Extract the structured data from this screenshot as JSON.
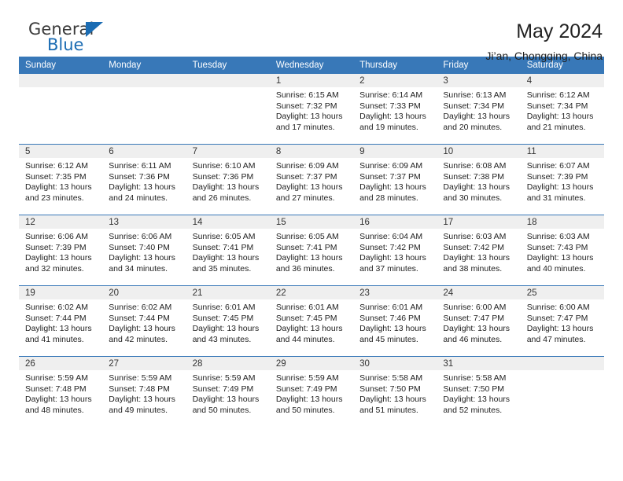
{
  "brand": {
    "word_one": "General",
    "word_two": "Blue",
    "triangle_icon": "triangle-icon",
    "accent_color": "#1b6cb3"
  },
  "header": {
    "title": "May 2024",
    "subtitle": "Ji’an, Chongqing, China"
  },
  "theme": {
    "header_blue": "#3878b8",
    "daynum_strip": "#efefef",
    "text": "#222222"
  },
  "calendar": {
    "weekday_headers": [
      "Sunday",
      "Monday",
      "Tuesday",
      "Wednesday",
      "Thursday",
      "Friday",
      "Saturday"
    ],
    "weeks": [
      [
        {
          "day": "",
          "sunrise": "",
          "sunset": "",
          "daylight_line1": "",
          "daylight_line2": "",
          "empty": true
        },
        {
          "day": "",
          "sunrise": "",
          "sunset": "",
          "daylight_line1": "",
          "daylight_line2": "",
          "empty": true
        },
        {
          "day": "",
          "sunrise": "",
          "sunset": "",
          "daylight_line1": "",
          "daylight_line2": "",
          "empty": true
        },
        {
          "day": "1",
          "sunrise": "Sunrise: 6:15 AM",
          "sunset": "Sunset: 7:32 PM",
          "daylight_line1": "Daylight: 13 hours",
          "daylight_line2": "and 17 minutes.",
          "empty": false
        },
        {
          "day": "2",
          "sunrise": "Sunrise: 6:14 AM",
          "sunset": "Sunset: 7:33 PM",
          "daylight_line1": "Daylight: 13 hours",
          "daylight_line2": "and 19 minutes.",
          "empty": false
        },
        {
          "day": "3",
          "sunrise": "Sunrise: 6:13 AM",
          "sunset": "Sunset: 7:34 PM",
          "daylight_line1": "Daylight: 13 hours",
          "daylight_line2": "and 20 minutes.",
          "empty": false
        },
        {
          "day": "4",
          "sunrise": "Sunrise: 6:12 AM",
          "sunset": "Sunset: 7:34 PM",
          "daylight_line1": "Daylight: 13 hours",
          "daylight_line2": "and 21 minutes.",
          "empty": false
        }
      ],
      [
        {
          "day": "5",
          "sunrise": "Sunrise: 6:12 AM",
          "sunset": "Sunset: 7:35 PM",
          "daylight_line1": "Daylight: 13 hours",
          "daylight_line2": "and 23 minutes.",
          "empty": false
        },
        {
          "day": "6",
          "sunrise": "Sunrise: 6:11 AM",
          "sunset": "Sunset: 7:36 PM",
          "daylight_line1": "Daylight: 13 hours",
          "daylight_line2": "and 24 minutes.",
          "empty": false
        },
        {
          "day": "7",
          "sunrise": "Sunrise: 6:10 AM",
          "sunset": "Sunset: 7:36 PM",
          "daylight_line1": "Daylight: 13 hours",
          "daylight_line2": "and 26 minutes.",
          "empty": false
        },
        {
          "day": "8",
          "sunrise": "Sunrise: 6:09 AM",
          "sunset": "Sunset: 7:37 PM",
          "daylight_line1": "Daylight: 13 hours",
          "daylight_line2": "and 27 minutes.",
          "empty": false
        },
        {
          "day": "9",
          "sunrise": "Sunrise: 6:09 AM",
          "sunset": "Sunset: 7:37 PM",
          "daylight_line1": "Daylight: 13 hours",
          "daylight_line2": "and 28 minutes.",
          "empty": false
        },
        {
          "day": "10",
          "sunrise": "Sunrise: 6:08 AM",
          "sunset": "Sunset: 7:38 PM",
          "daylight_line1": "Daylight: 13 hours",
          "daylight_line2": "and 30 minutes.",
          "empty": false
        },
        {
          "day": "11",
          "sunrise": "Sunrise: 6:07 AM",
          "sunset": "Sunset: 7:39 PM",
          "daylight_line1": "Daylight: 13 hours",
          "daylight_line2": "and 31 minutes.",
          "empty": false
        }
      ],
      [
        {
          "day": "12",
          "sunrise": "Sunrise: 6:06 AM",
          "sunset": "Sunset: 7:39 PM",
          "daylight_line1": "Daylight: 13 hours",
          "daylight_line2": "and 32 minutes.",
          "empty": false
        },
        {
          "day": "13",
          "sunrise": "Sunrise: 6:06 AM",
          "sunset": "Sunset: 7:40 PM",
          "daylight_line1": "Daylight: 13 hours",
          "daylight_line2": "and 34 minutes.",
          "empty": false
        },
        {
          "day": "14",
          "sunrise": "Sunrise: 6:05 AM",
          "sunset": "Sunset: 7:41 PM",
          "daylight_line1": "Daylight: 13 hours",
          "daylight_line2": "and 35 minutes.",
          "empty": false
        },
        {
          "day": "15",
          "sunrise": "Sunrise: 6:05 AM",
          "sunset": "Sunset: 7:41 PM",
          "daylight_line1": "Daylight: 13 hours",
          "daylight_line2": "and 36 minutes.",
          "empty": false
        },
        {
          "day": "16",
          "sunrise": "Sunrise: 6:04 AM",
          "sunset": "Sunset: 7:42 PM",
          "daylight_line1": "Daylight: 13 hours",
          "daylight_line2": "and 37 minutes.",
          "empty": false
        },
        {
          "day": "17",
          "sunrise": "Sunrise: 6:03 AM",
          "sunset": "Sunset: 7:42 PM",
          "daylight_line1": "Daylight: 13 hours",
          "daylight_line2": "and 38 minutes.",
          "empty": false
        },
        {
          "day": "18",
          "sunrise": "Sunrise: 6:03 AM",
          "sunset": "Sunset: 7:43 PM",
          "daylight_line1": "Daylight: 13 hours",
          "daylight_line2": "and 40 minutes.",
          "empty": false
        }
      ],
      [
        {
          "day": "19",
          "sunrise": "Sunrise: 6:02 AM",
          "sunset": "Sunset: 7:44 PM",
          "daylight_line1": "Daylight: 13 hours",
          "daylight_line2": "and 41 minutes.",
          "empty": false
        },
        {
          "day": "20",
          "sunrise": "Sunrise: 6:02 AM",
          "sunset": "Sunset: 7:44 PM",
          "daylight_line1": "Daylight: 13 hours",
          "daylight_line2": "and 42 minutes.",
          "empty": false
        },
        {
          "day": "21",
          "sunrise": "Sunrise: 6:01 AM",
          "sunset": "Sunset: 7:45 PM",
          "daylight_line1": "Daylight: 13 hours",
          "daylight_line2": "and 43 minutes.",
          "empty": false
        },
        {
          "day": "22",
          "sunrise": "Sunrise: 6:01 AM",
          "sunset": "Sunset: 7:45 PM",
          "daylight_line1": "Daylight: 13 hours",
          "daylight_line2": "and 44 minutes.",
          "empty": false
        },
        {
          "day": "23",
          "sunrise": "Sunrise: 6:01 AM",
          "sunset": "Sunset: 7:46 PM",
          "daylight_line1": "Daylight: 13 hours",
          "daylight_line2": "and 45 minutes.",
          "empty": false
        },
        {
          "day": "24",
          "sunrise": "Sunrise: 6:00 AM",
          "sunset": "Sunset: 7:47 PM",
          "daylight_line1": "Daylight: 13 hours",
          "daylight_line2": "and 46 minutes.",
          "empty": false
        },
        {
          "day": "25",
          "sunrise": "Sunrise: 6:00 AM",
          "sunset": "Sunset: 7:47 PM",
          "daylight_line1": "Daylight: 13 hours",
          "daylight_line2": "and 47 minutes.",
          "empty": false
        }
      ],
      [
        {
          "day": "26",
          "sunrise": "Sunrise: 5:59 AM",
          "sunset": "Sunset: 7:48 PM",
          "daylight_line1": "Daylight: 13 hours",
          "daylight_line2": "and 48 minutes.",
          "empty": false
        },
        {
          "day": "27",
          "sunrise": "Sunrise: 5:59 AM",
          "sunset": "Sunset: 7:48 PM",
          "daylight_line1": "Daylight: 13 hours",
          "daylight_line2": "and 49 minutes.",
          "empty": false
        },
        {
          "day": "28",
          "sunrise": "Sunrise: 5:59 AM",
          "sunset": "Sunset: 7:49 PM",
          "daylight_line1": "Daylight: 13 hours",
          "daylight_line2": "and 50 minutes.",
          "empty": false
        },
        {
          "day": "29",
          "sunrise": "Sunrise: 5:59 AM",
          "sunset": "Sunset: 7:49 PM",
          "daylight_line1": "Daylight: 13 hours",
          "daylight_line2": "and 50 minutes.",
          "empty": false
        },
        {
          "day": "30",
          "sunrise": "Sunrise: 5:58 AM",
          "sunset": "Sunset: 7:50 PM",
          "daylight_line1": "Daylight: 13 hours",
          "daylight_line2": "and 51 minutes.",
          "empty": false
        },
        {
          "day": "31",
          "sunrise": "Sunrise: 5:58 AM",
          "sunset": "Sunset: 7:50 PM",
          "daylight_line1": "Daylight: 13 hours",
          "daylight_line2": "and 52 minutes.",
          "empty": false
        },
        {
          "day": "",
          "sunrise": "",
          "sunset": "",
          "daylight_line1": "",
          "daylight_line2": "",
          "empty": true
        }
      ]
    ]
  }
}
